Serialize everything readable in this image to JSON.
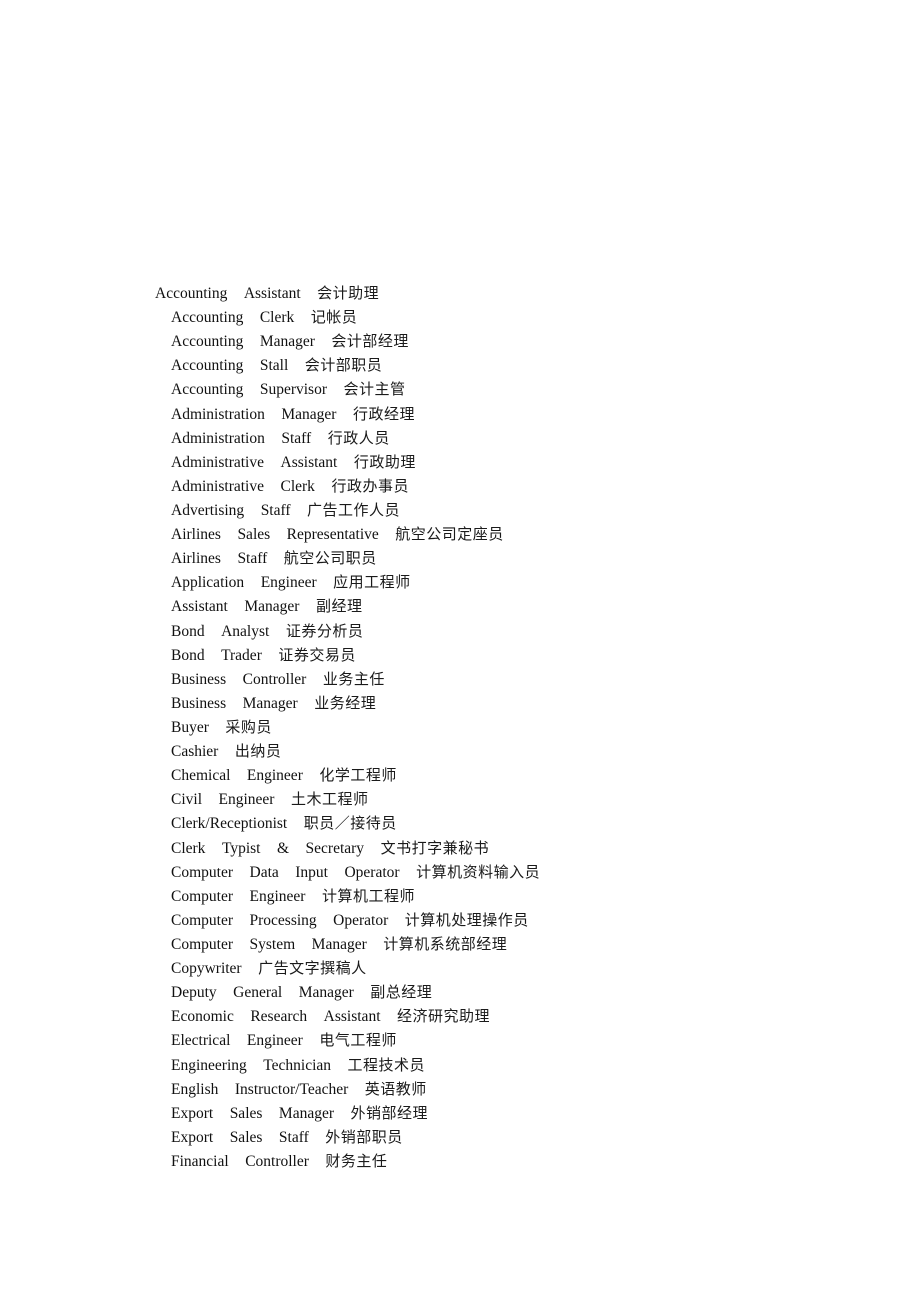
{
  "document": {
    "entries": [
      {
        "en": "Accounting Assistant",
        "zh": "会计助理"
      },
      {
        "en": "Accounting Clerk",
        "zh": "记帐员"
      },
      {
        "en": "Accounting Manager",
        "zh": "会计部经理"
      },
      {
        "en": "Accounting Stall",
        "zh": "会计部职员"
      },
      {
        "en": "Accounting Supervisor",
        "zh": "会计主管"
      },
      {
        "en": "Administration Manager",
        "zh": "行政经理"
      },
      {
        "en": "Administration Staff",
        "zh": "行政人员"
      },
      {
        "en": "Administrative Assistant",
        "zh": "行政助理"
      },
      {
        "en": "Administrative Clerk",
        "zh": "行政办事员"
      },
      {
        "en": "Advertising Staff",
        "zh": "广告工作人员"
      },
      {
        "en": "Airlines Sales Representative",
        "zh": "航空公司定座员"
      },
      {
        "en": "Airlines Staff",
        "zh": "航空公司职员"
      },
      {
        "en": "Application Engineer",
        "zh": "应用工程师"
      },
      {
        "en": "Assistant Manager",
        "zh": "副经理"
      },
      {
        "en": "Bond Analyst",
        "zh": "证券分析员"
      },
      {
        "en": "Bond Trader",
        "zh": "证券交易员"
      },
      {
        "en": "Business Controller",
        "zh": "业务主任"
      },
      {
        "en": "Business Manager",
        "zh": "业务经理"
      },
      {
        "en": "Buyer",
        "zh": "采购员"
      },
      {
        "en": "Cashier",
        "zh": "出纳员"
      },
      {
        "en": "Chemical Engineer",
        "zh": "化学工程师"
      },
      {
        "en": "Civil Engineer",
        "zh": "土木工程师"
      },
      {
        "en": "Clerk/Receptionist",
        "zh": "职员／接待员"
      },
      {
        "en": "Clerk Typist & Secretary",
        "zh": "文书打字兼秘书"
      },
      {
        "en": "Computer Data Input Operator",
        "zh": "计算机资料输入员"
      },
      {
        "en": "Computer Engineer",
        "zh": "计算机工程师"
      },
      {
        "en": "Computer Processing Operator",
        "zh": "计算机处理操作员"
      },
      {
        "en": "Computer System Manager",
        "zh": "计算机系统部经理"
      },
      {
        "en": "Copywriter",
        "zh": "广告文字撰稿人"
      },
      {
        "en": "Deputy General Manager",
        "zh": "副总经理"
      },
      {
        "en": "Economic Research Assistant",
        "zh": "经济研究助理"
      },
      {
        "en": "Electrical Engineer",
        "zh": "电气工程师"
      },
      {
        "en": "Engineering Technician",
        "zh": "工程技术员"
      },
      {
        "en": "English Instructor/Teacher",
        "zh": "英语教师"
      },
      {
        "en": "Export Sales Manager",
        "zh": "外销部经理"
      },
      {
        "en": "Export Sales Staff",
        "zh": "外销部职员"
      },
      {
        "en": "Financial Controller",
        "zh": "财务主任"
      }
    ]
  }
}
